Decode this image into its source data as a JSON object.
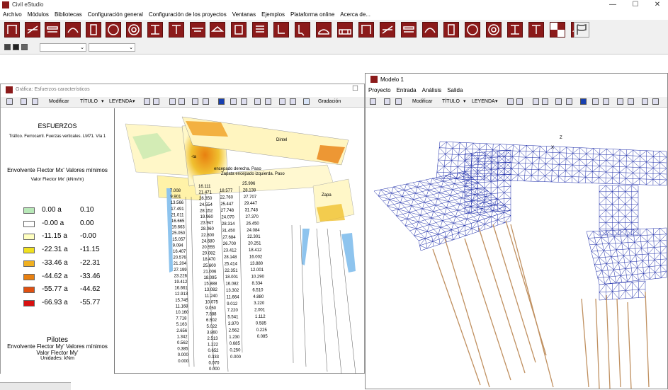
{
  "app": {
    "title": "Civil eStudio",
    "min": "—",
    "max": "☐",
    "close": "✕"
  },
  "menu": [
    "Archivo",
    "Módulos",
    "Bibliotecas",
    "Configuración general",
    "Configuración de los proyectos",
    "Ventanas",
    "Ejemplos",
    "Plataforma online",
    "Acerca de..."
  ],
  "toolbar_icons": [
    "frame-icon",
    "bridge-icon",
    "slab-icon",
    "arch-icon",
    "column-icon",
    "circle-section-icon",
    "hollow-circle-icon",
    "i-beam-icon",
    "t-beam-icon",
    "girder-icon",
    "deck-icon",
    "wall-icon",
    "grid-icon",
    "retaining-wall-icon",
    "abutment-icon",
    "culvert-icon",
    "box-culvert-icon",
    "pile-icon",
    "pier-icon",
    "hammerhead-icon",
    "pier-cap-icon",
    "truss-icon",
    "arch-bridge-icon",
    "deck-girder-icon",
    "portal-icon",
    "tripod-icon",
    "bent-icon",
    "cap-beam-icon",
    "checker-icon",
    "flag-icon"
  ],
  "chart_window": {
    "title": "Gráfica: Esfuerzos característicos",
    "modify": "Modificar",
    "title_btn": "TÍTULO",
    "legend_btn": "LEYENDA",
    "gradation": "Gradación",
    "heading": "ESFUERZOS",
    "subheading": "Tráfico. Ferrocarril. Fuerzas verticales. LM71. Vía 1",
    "envelope": "Envolvente Flector Mx' Valores mínimos",
    "value_label": "Valor Flector Mx' (kNm/m)",
    "legend": [
      {
        "from": "0.00 a",
        "to": "0.10",
        "color": "#b8e8b8"
      },
      {
        "from": "-0.00 a",
        "to": "0.00",
        "color": "#ffffff"
      },
      {
        "from": "-11.15 a",
        "to": "-0.00",
        "color": "#ffffc0"
      },
      {
        "from": "-22.31 a",
        "to": "-11.15",
        "color": "#f0e020"
      },
      {
        "from": "-33.46 a",
        "to": "-22.31",
        "color": "#f0b020"
      },
      {
        "from": "-44.62 a",
        "to": "-33.46",
        "color": "#e88010"
      },
      {
        "from": "-55.77 a",
        "to": "-44.62",
        "color": "#e05010"
      },
      {
        "from": "-66.93 a",
        "to": "-55.77",
        "color": "#d81010"
      }
    ],
    "piles_title": "Pilotes",
    "piles_env": "Envolvente Flector My' Valores mínimos",
    "piles_value": "Valor Flector My'",
    "piles_units": "Unidades: kNm",
    "labels": {
      "dintel": "Dintel",
      "encepado_der": "encepado derecha. Paso",
      "zapata_izq": "Zapata encepado izquierda. Paso",
      "zapa": "Zapa",
      "ta": "-ta"
    },
    "pile_values_left": [
      "7.008",
      "9.901",
      "13.566",
      "17.491",
      "21.011",
      "16.665",
      "19.663",
      "25.050",
      "15.057",
      "9.094",
      "16.407",
      "20.576",
      "21.204",
      "27.199",
      "23.226",
      "19.412",
      "16.661",
      "12.913",
      "15.745",
      "11.168",
      "10.160",
      "7.718",
      "5.163",
      "2.656",
      "1.342",
      "0.562",
      "0.385",
      "0.000",
      "0.000"
    ],
    "pile_values_mid": [
      "16.111",
      "21.471",
      "26.350",
      "24.554",
      "28.152",
      "19.960",
      "23.947",
      "28.060",
      "22.800",
      "24.680",
      "20.555",
      "20.082",
      "18.470",
      "25.600",
      "21.006",
      "18.095",
      "15.888",
      "13.082",
      "11.240",
      "10.075",
      "9.050",
      "7.888",
      "6.502",
      "5.022",
      "3.860",
      "2.513",
      "1.222",
      "0.652",
      "0.333",
      "0.070",
      "0.000"
    ],
    "pile_values_right": [
      "18.577",
      "22.760",
      "25.447",
      "27.748",
      "24.070",
      "28.314",
      "31.450",
      "27.684",
      "26.700",
      "23.412",
      "28.148",
      "25.414",
      "22.351",
      "18.001",
      "16.082",
      "13.302",
      "11.664",
      "9.012",
      "7.220",
      "5.541",
      "3.970",
      "2.562",
      "1.230",
      "0.685",
      "0.250",
      "0.000"
    ],
    "pile_values_far": [
      "25.996",
      "28.138",
      "27.707",
      "29.447",
      "31.748",
      "27.370",
      "26.450",
      "24.084",
      "22.301",
      "20.251",
      "18.412",
      "16.002",
      "13.880",
      "12.001",
      "10.290",
      "8.334",
      "6.510",
      "4.880",
      "3.220",
      "2.001",
      "1.112",
      "0.585",
      "0.225",
      "0.085"
    ]
  },
  "model_window": {
    "title": "Modelo 1",
    "menu": [
      "Proyecto",
      "Entrada",
      "Análisis",
      "Salida"
    ],
    "modify": "Modificar",
    "title_btn": "TÍTULO",
    "legend_btn": "LEYENDA",
    "axis_z": "Z",
    "axis_x": "X"
  }
}
